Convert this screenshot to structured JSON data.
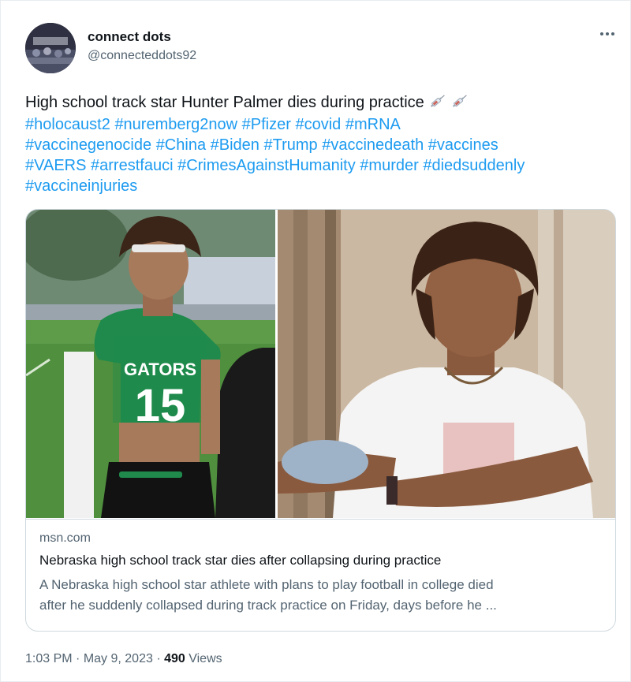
{
  "author": {
    "name": "connect dots",
    "handle": "@connecteddots92",
    "avatar_icon": "avatar-dark-crowd"
  },
  "more_icon": "more-horizontal-icon",
  "tweet": {
    "text_line1": "High school track star Hunter Palmer dies during practice",
    "syringe_icon": "syringe-emoji",
    "hashtags": [
      [
        "#holocaust2",
        "#nuremberg2now",
        "#Pfizer",
        "#covid",
        "#mRNA"
      ],
      [
        "#vaccinegenocide",
        "#China",
        "#Biden",
        "#Trump",
        "#vaccinedeath",
        "#vaccines"
      ],
      [
        "#VAERS",
        "#arrestfauci",
        "#CrimesAgainstHumanity",
        "#murder",
        "#diedsuddenly"
      ],
      [
        "#vaccineinjuries"
      ]
    ]
  },
  "link_card": {
    "domain": "msn.com",
    "title": "Nebraska high school track star dies after collapsing during practice",
    "description_line1": "A Nebraska high school star athlete with plans to play football in college died",
    "description_line2": "after he suddenly collapsed during track practice on Friday, days before he ...",
    "photo_left": {
      "jersey_text": "GATORS",
      "jersey_number": "15"
    }
  },
  "meta": {
    "time": "1:03 PM",
    "sep1": " · ",
    "date": "May 9, 2023",
    "sep2": " · ",
    "views_count": "490",
    "views_label": " Views"
  },
  "colors": {
    "hashtag": "#1d9bf0",
    "secondary_text": "#536471",
    "border": "#cfd9de",
    "jersey_green": "#1f8a4c"
  }
}
